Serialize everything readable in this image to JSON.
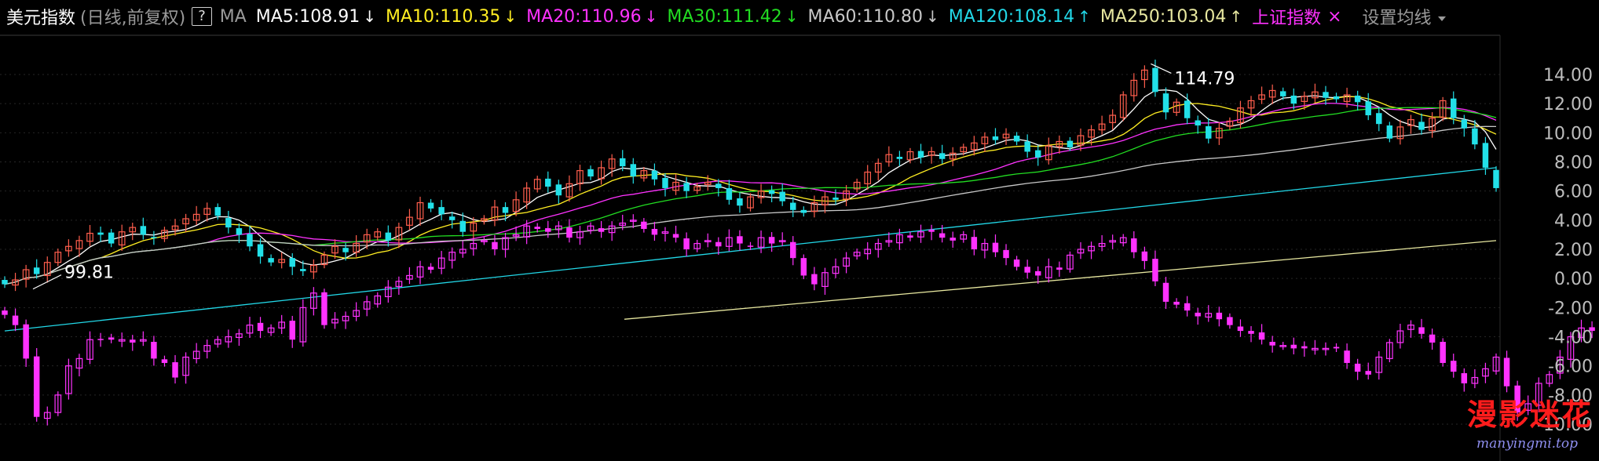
{
  "header": {
    "title": "美元指数",
    "subtitle": "(日线,前复权)",
    "help": "?",
    "ma_label": "MA",
    "indicators": [
      {
        "text": "MA5:108.91",
        "arrow": "↓",
        "color": "#ffffff"
      },
      {
        "text": "MA10:110.35",
        "arrow": "↓",
        "color": "#ffee22"
      },
      {
        "text": "MA20:110.96",
        "arrow": "↓",
        "color": "#ff32ff"
      },
      {
        "text": "MA30:111.42",
        "arrow": "↓",
        "color": "#22dd22"
      },
      {
        "text": "MA60:110.80",
        "arrow": "↓",
        "color": "#c8c8c8"
      },
      {
        "text": "MA120:108.14",
        "arrow": "↑",
        "color": "#22d8e8"
      },
      {
        "text": "MA250:103.04",
        "arrow": "↑",
        "color": "#e8e8a0"
      }
    ],
    "overlay": {
      "label": "上证指数",
      "close": "×",
      "color": "#ff32ff"
    },
    "settings": "设置均线"
  },
  "watermark": {
    "text": "漫影迷花",
    "url": "manyingmi.top"
  },
  "chart_data": {
    "type": "candlestick",
    "series": [
      {
        "name": "美元指数",
        "color_up": "#ff5e4d",
        "color_down": "#22e0e8"
      },
      {
        "name": "上证指数",
        "color": "#ff32ff"
      }
    ],
    "y_ticks": [
      "14.00",
      "12.00",
      "10.00",
      "8.00",
      "6.00",
      "4.00",
      "2.00",
      "0.00",
      "-2.00",
      "-4.00",
      "-6.00",
      "-8.00",
      "-10.00"
    ],
    "y_range": [
      -10,
      14
    ],
    "annotations": [
      {
        "label": "99.81",
        "type": "low"
      },
      {
        "label": "114.79",
        "type": "high"
      }
    ],
    "main_closes": [
      -0.4,
      -0.1,
      0.6,
      0.3,
      1.1,
      1.8,
      2.2,
      2.6,
      3.1,
      3.0,
      2.4,
      3.2,
      3.5,
      3.0,
      2.8,
      3.3,
      3.6,
      4.1,
      4.4,
      4.8,
      4.3,
      3.5,
      3.0,
      2.2,
      1.5,
      1.1,
      1.3,
      0.8,
      0.5,
      0.9,
      1.6,
      2.2,
      1.8,
      2.4,
      3.0,
      3.2,
      2.6,
      3.5,
      4.2,
      5.2,
      4.8,
      4.4,
      4.0,
      3.2,
      3.8,
      4.1,
      4.9,
      4.5,
      5.4,
      6.2,
      6.8,
      6.3,
      5.7,
      6.5,
      7.4,
      7.0,
      7.6,
      8.2,
      7.7,
      7.0,
      7.4,
      6.8,
      6.2,
      6.6,
      6.0,
      6.3,
      6.6,
      6.2,
      5.4,
      5.0,
      5.6,
      6.0,
      5.8,
      5.3,
      4.7,
      4.5,
      5.2,
      5.6,
      5.4,
      6.0,
      6.6,
      7.3,
      7.9,
      8.5,
      8.2,
      8.7,
      8.3,
      8.7,
      8.2,
      8.6,
      9.0,
      9.3,
      9.7,
      9.5,
      9.9,
      9.4,
      8.7,
      8.3,
      9.1,
      9.4,
      9.0,
      9.8,
      10.2,
      10.6,
      11.2,
      12.6,
      13.6,
      14.3,
      12.8,
      11.4,
      12.1,
      11.0,
      10.5,
      9.6,
      10.3,
      10.8,
      11.7,
      12.2,
      12.6,
      12.9,
      12.5,
      12.0,
      12.5,
      12.8,
      12.4,
      12.3,
      12.6,
      12.1,
      11.2,
      10.6,
      9.6,
      10.4,
      10.9,
      10.2,
      11.0,
      12.2,
      11.0,
      10.3,
      9.2,
      7.6,
      6.2
    ],
    "overlay_closes": [
      -2.5,
      -3.2,
      -5.5,
      -9.5,
      -9.2,
      -8.0,
      -6.0,
      -5.5,
      -4.2,
      -4.2,
      -4.2,
      -4.2,
      -4.4,
      -4.2,
      -5.5,
      -5.8,
      -6.8,
      -5.4,
      -5.0,
      -4.6,
      -4.2,
      -4.0,
      -3.8,
      -3.2,
      -3.6,
      -3.4,
      -3.0,
      -4.2,
      -2.0,
      -1.0,
      -3.2,
      -2.8,
      -2.6,
      -2.2,
      -1.6,
      -1.2,
      -0.6,
      -0.2,
      0.2,
      0.8,
      0.6,
      1.4,
      1.8,
      2.0,
      2.4,
      2.6,
      2.0,
      2.8,
      3.0,
      3.6,
      3.4,
      3.2,
      3.6,
      2.8,
      3.2,
      3.6,
      3.2,
      3.6,
      3.8,
      4.0,
      3.4,
      3.0,
      3.2,
      2.8,
      2.0,
      2.4,
      2.6,
      2.2,
      2.8,
      2.4,
      2.2,
      2.8,
      2.4,
      2.6,
      1.4,
      0.2,
      -0.4,
      0.4,
      0.8,
      1.4,
      1.8,
      2.0,
      2.4,
      2.6,
      3.0,
      2.8,
      3.2,
      3.2,
      2.8,
      2.6,
      3.0,
      2.0,
      2.4,
      1.8,
      1.4,
      0.8,
      0.4,
      0.2,
      0.8,
      0.6,
      1.6,
      2.0,
      2.2,
      2.4,
      2.6,
      2.8,
      1.8,
      1.2,
      -0.2,
      -1.6,
      -1.8,
      -2.2,
      -2.6,
      -2.4,
      -2.8,
      -3.2,
      -3.6,
      -3.8,
      -4.2,
      -4.6,
      -4.6,
      -4.8,
      -4.8,
      -4.8,
      -4.8,
      -4.8,
      -5.8,
      -6.4,
      -6.6,
      -5.4,
      -4.4,
      -3.6,
      -3.2,
      -3.8,
      -4.4,
      -5.8,
      -6.4,
      -7.2,
      -6.8,
      -6.2,
      -5.4,
      -7.4,
      -9.2,
      -8.6,
      -7.2,
      -6.6,
      -5.4,
      -4.0,
      -3.4,
      -3.6,
      -3.8,
      -4.2,
      -2.8
    ]
  }
}
